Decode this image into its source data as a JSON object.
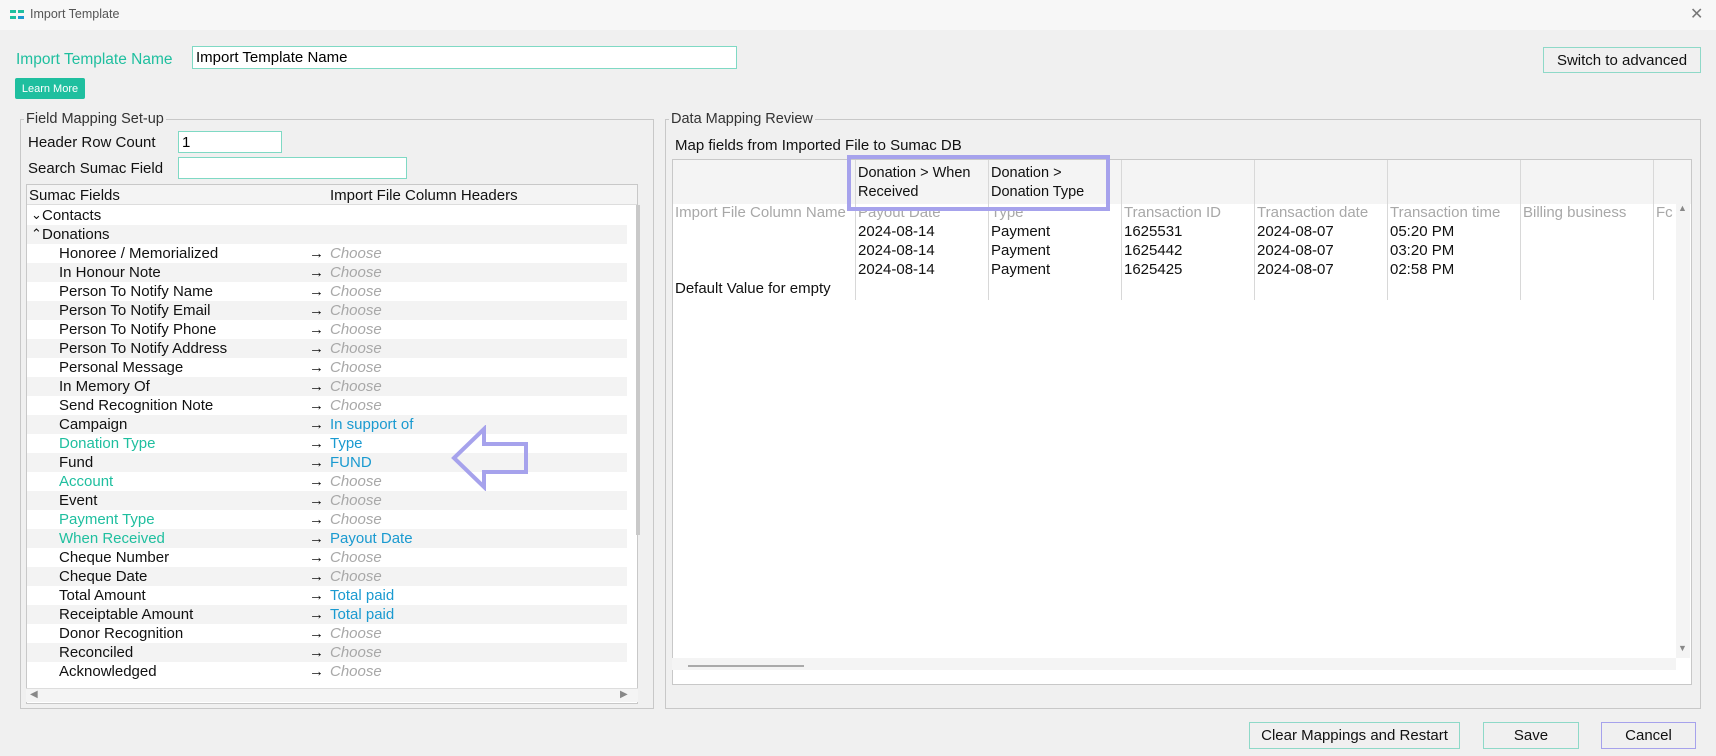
{
  "window": {
    "title": "Import Template",
    "close_icon": "close-icon"
  },
  "header": {
    "template_name_label": "Import Template Name",
    "template_name_value": "Import Template Name",
    "learn_more_label": "Learn More",
    "switch_advanced_label": "Switch to advanced"
  },
  "field_mapping": {
    "legend": "Field Mapping Set-up",
    "header_row_count_label": "Header Row Count",
    "header_row_count_value": "1",
    "search_label": "Search Sumac Field",
    "search_value": "",
    "col_sumac_fields": "Sumac Fields",
    "col_import_headers": "Import File Column Headers",
    "groups": [
      {
        "label": "Contacts",
        "expanded": false
      },
      {
        "label": "Donations",
        "expanded": true
      }
    ],
    "arrow_glyph": "→",
    "rows": [
      {
        "field": "Honoree / Memorialized",
        "mapping": "Choose",
        "field_highlight": false,
        "mapped": false
      },
      {
        "field": "In Honour Note",
        "mapping": "Choose",
        "field_highlight": false,
        "mapped": false
      },
      {
        "field": "Person To Notify Name",
        "mapping": "Choose",
        "field_highlight": false,
        "mapped": false
      },
      {
        "field": "Person To Notify Email",
        "mapping": "Choose",
        "field_highlight": false,
        "mapped": false
      },
      {
        "field": "Person To Notify Phone",
        "mapping": "Choose",
        "field_highlight": false,
        "mapped": false
      },
      {
        "field": "Person To Notify Address",
        "mapping": "Choose",
        "field_highlight": false,
        "mapped": false
      },
      {
        "field": "Personal Message",
        "mapping": "Choose",
        "field_highlight": false,
        "mapped": false
      },
      {
        "field": "In Memory Of",
        "mapping": "Choose",
        "field_highlight": false,
        "mapped": false
      },
      {
        "field": "Send Recognition Note",
        "mapping": "Choose",
        "field_highlight": false,
        "mapped": false
      },
      {
        "field": "Campaign",
        "mapping": "In support of",
        "field_highlight": false,
        "mapped": true
      },
      {
        "field": "Donation Type",
        "mapping": "Type",
        "field_highlight": true,
        "mapped": true
      },
      {
        "field": "Fund",
        "mapping": "FUND",
        "field_highlight": false,
        "mapped": true
      },
      {
        "field": "Account",
        "mapping": "Choose",
        "field_highlight": true,
        "mapped": false
      },
      {
        "field": "Event",
        "mapping": "Choose",
        "field_highlight": false,
        "mapped": false
      },
      {
        "field": "Payment Type",
        "mapping": "Choose",
        "field_highlight": true,
        "mapped": false
      },
      {
        "field": "When Received",
        "mapping": "Payout Date",
        "field_highlight": true,
        "mapped": true
      },
      {
        "field": "Cheque Number",
        "mapping": "Choose",
        "field_highlight": false,
        "mapped": false
      },
      {
        "field": "Cheque Date",
        "mapping": "Choose",
        "field_highlight": false,
        "mapped": false
      },
      {
        "field": "Total Amount",
        "mapping": "Total paid",
        "field_highlight": false,
        "mapped": true
      },
      {
        "field": "Receiptable Amount",
        "mapping": "Total paid",
        "field_highlight": false,
        "mapped": true
      },
      {
        "field": "Donor Recognition",
        "mapping": "Choose",
        "field_highlight": false,
        "mapped": false
      },
      {
        "field": "Reconciled",
        "mapping": "Choose",
        "field_highlight": false,
        "mapped": false
      },
      {
        "field": "Acknowledged",
        "mapping": "Choose",
        "field_highlight": false,
        "mapped": false
      }
    ]
  },
  "review": {
    "legend": "Data Mapping Review",
    "subtitle": "Map fields from Imported File to Sumac DB",
    "row_label_import_col": "Import File Column Name",
    "row_label_default": "Default Value for empty",
    "mapped_headers": [
      {
        "line1": "Donation > When",
        "line2": "Received"
      },
      {
        "line1": "Donation >",
        "line2": "Donation Type"
      },
      {
        "line1": "",
        "line2": ""
      },
      {
        "line1": "",
        "line2": ""
      },
      {
        "line1": "",
        "line2": ""
      },
      {
        "line1": "",
        "line2": ""
      },
      {
        "line1": "",
        "line2": ""
      }
    ],
    "columns": [
      "Payout Date",
      "Type",
      "Transaction ID",
      "Transaction date",
      "Transaction time",
      "Billing business",
      "Fc"
    ],
    "data_rows": [
      [
        "2024-08-14",
        "Payment",
        "1625531",
        "2024-08-07",
        "05:20 PM",
        "",
        ""
      ],
      [
        "2024-08-14",
        "Payment",
        "1625442",
        "2024-08-07",
        "03:20 PM",
        "",
        ""
      ],
      [
        "2024-08-14",
        "Payment",
        "1625425",
        "2024-08-07",
        "02:58 PM",
        "",
        ""
      ]
    ]
  },
  "footer": {
    "clear_label": "Clear Mappings and Restart",
    "save_label": "Save",
    "cancel_label": "Cancel"
  },
  "colors": {
    "accent": "#1fbf9f",
    "mapped_blue": "#1a9ad0",
    "annotation": "#a6a2ec"
  }
}
